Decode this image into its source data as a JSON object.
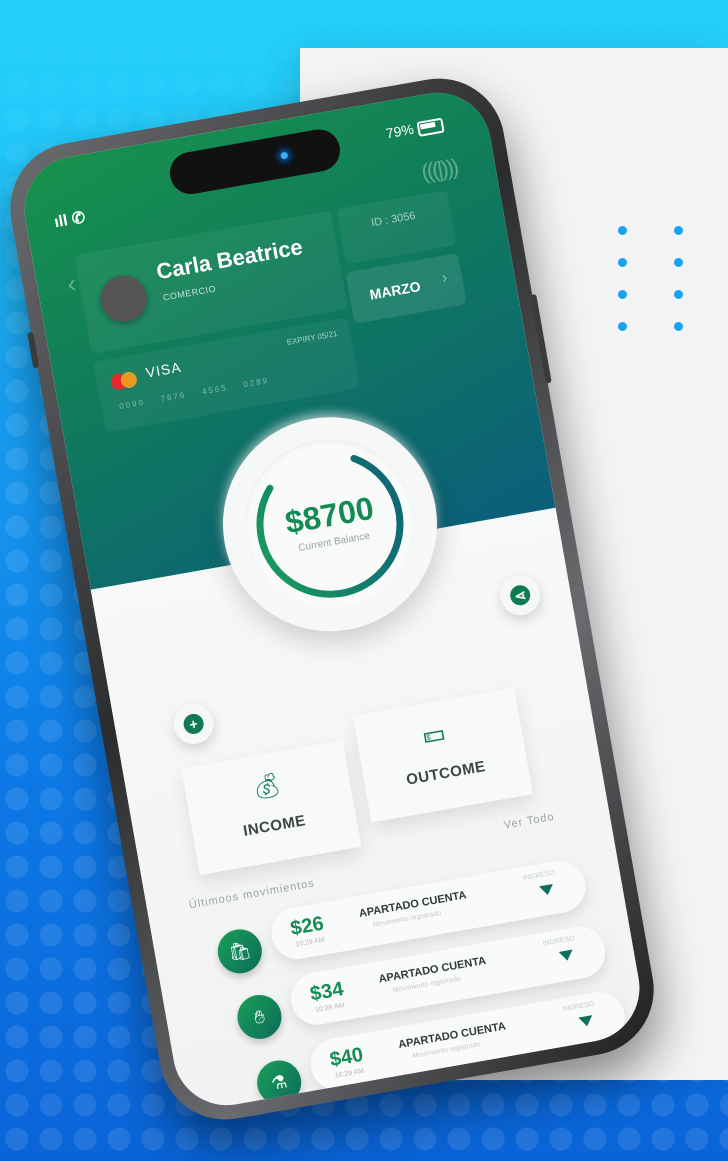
{
  "status": {
    "battery": "79%"
  },
  "profile": {
    "name": "Carla Beatrice",
    "role": "COMERCIO",
    "id": "ID : 3056",
    "month": "MARZO"
  },
  "card": {
    "brand": "VISA",
    "expiry": "EXPIRY 05/21",
    "number": "0090 7676 4565 0289"
  },
  "balance": {
    "value": "$8700",
    "label": "Current Balance",
    "progress": 0.78
  },
  "actions": {
    "income": "INCOME",
    "outcome": "OUTCOME"
  },
  "movements": {
    "title": "Últimoos movimientos",
    "see_all": "Ver Todo",
    "items": [
      {
        "amount": "$26",
        "time": "10:29 AM",
        "title": "APARTADO CUENTA",
        "subtitle": "Movimiento registrado",
        "type": "INGRESO",
        "icon": "shopping-bag-icon"
      },
      {
        "amount": "$34",
        "time": "10:29 AM",
        "title": "APARTADO CUENTA",
        "subtitle": "Movimiento registrado",
        "type": "INGRESO",
        "icon": "hand-money-icon"
      },
      {
        "amount": "$40",
        "time": "10:29 AM",
        "title": "APARTADO CUENTA",
        "subtitle": "Movimiento registrado",
        "type": "INGRESO",
        "icon": "flask-icon"
      }
    ]
  },
  "colors": {
    "accent": "#138b53",
    "header_start": "#18924d",
    "header_end": "#0c5e7c",
    "background": "#1aa4f3"
  }
}
